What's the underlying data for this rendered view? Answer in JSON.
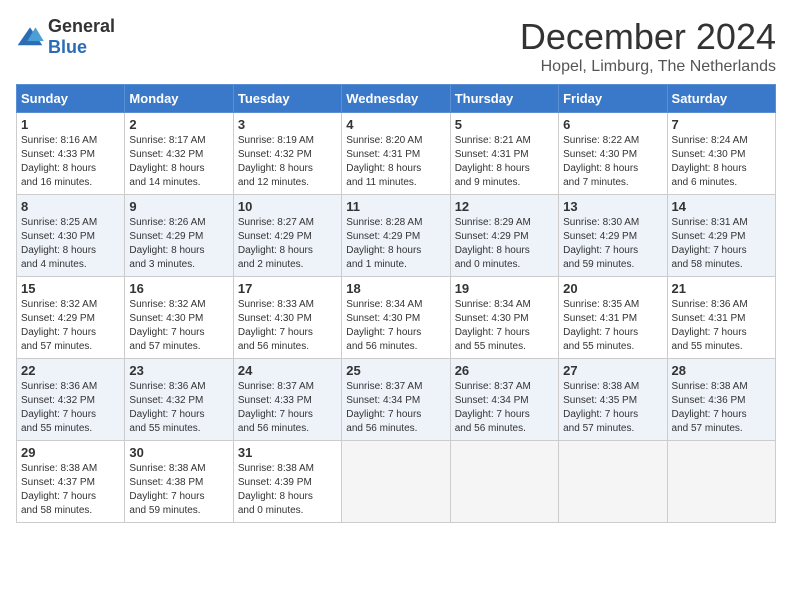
{
  "logo": {
    "general": "General",
    "blue": "Blue"
  },
  "title": "December 2024",
  "location": "Hopel, Limburg, The Netherlands",
  "days_of_week": [
    "Sunday",
    "Monday",
    "Tuesday",
    "Wednesday",
    "Thursday",
    "Friday",
    "Saturday"
  ],
  "weeks": [
    [
      {
        "day": "1",
        "info": "Sunrise: 8:16 AM\nSunset: 4:33 PM\nDaylight: 8 hours\nand 16 minutes."
      },
      {
        "day": "2",
        "info": "Sunrise: 8:17 AM\nSunset: 4:32 PM\nDaylight: 8 hours\nand 14 minutes."
      },
      {
        "day": "3",
        "info": "Sunrise: 8:19 AM\nSunset: 4:32 PM\nDaylight: 8 hours\nand 12 minutes."
      },
      {
        "day": "4",
        "info": "Sunrise: 8:20 AM\nSunset: 4:31 PM\nDaylight: 8 hours\nand 11 minutes."
      },
      {
        "day": "5",
        "info": "Sunrise: 8:21 AM\nSunset: 4:31 PM\nDaylight: 8 hours\nand 9 minutes."
      },
      {
        "day": "6",
        "info": "Sunrise: 8:22 AM\nSunset: 4:30 PM\nDaylight: 8 hours\nand 7 minutes."
      },
      {
        "day": "7",
        "info": "Sunrise: 8:24 AM\nSunset: 4:30 PM\nDaylight: 8 hours\nand 6 minutes."
      }
    ],
    [
      {
        "day": "8",
        "info": "Sunrise: 8:25 AM\nSunset: 4:30 PM\nDaylight: 8 hours\nand 4 minutes."
      },
      {
        "day": "9",
        "info": "Sunrise: 8:26 AM\nSunset: 4:29 PM\nDaylight: 8 hours\nand 3 minutes."
      },
      {
        "day": "10",
        "info": "Sunrise: 8:27 AM\nSunset: 4:29 PM\nDaylight: 8 hours\nand 2 minutes."
      },
      {
        "day": "11",
        "info": "Sunrise: 8:28 AM\nSunset: 4:29 PM\nDaylight: 8 hours\nand 1 minute."
      },
      {
        "day": "12",
        "info": "Sunrise: 8:29 AM\nSunset: 4:29 PM\nDaylight: 8 hours\nand 0 minutes."
      },
      {
        "day": "13",
        "info": "Sunrise: 8:30 AM\nSunset: 4:29 PM\nDaylight: 7 hours\nand 59 minutes."
      },
      {
        "day": "14",
        "info": "Sunrise: 8:31 AM\nSunset: 4:29 PM\nDaylight: 7 hours\nand 58 minutes."
      }
    ],
    [
      {
        "day": "15",
        "info": "Sunrise: 8:32 AM\nSunset: 4:29 PM\nDaylight: 7 hours\nand 57 minutes."
      },
      {
        "day": "16",
        "info": "Sunrise: 8:32 AM\nSunset: 4:30 PM\nDaylight: 7 hours\nand 57 minutes."
      },
      {
        "day": "17",
        "info": "Sunrise: 8:33 AM\nSunset: 4:30 PM\nDaylight: 7 hours\nand 56 minutes."
      },
      {
        "day": "18",
        "info": "Sunrise: 8:34 AM\nSunset: 4:30 PM\nDaylight: 7 hours\nand 56 minutes."
      },
      {
        "day": "19",
        "info": "Sunrise: 8:34 AM\nSunset: 4:30 PM\nDaylight: 7 hours\nand 55 minutes."
      },
      {
        "day": "20",
        "info": "Sunrise: 8:35 AM\nSunset: 4:31 PM\nDaylight: 7 hours\nand 55 minutes."
      },
      {
        "day": "21",
        "info": "Sunrise: 8:36 AM\nSunset: 4:31 PM\nDaylight: 7 hours\nand 55 minutes."
      }
    ],
    [
      {
        "day": "22",
        "info": "Sunrise: 8:36 AM\nSunset: 4:32 PM\nDaylight: 7 hours\nand 55 minutes."
      },
      {
        "day": "23",
        "info": "Sunrise: 8:36 AM\nSunset: 4:32 PM\nDaylight: 7 hours\nand 55 minutes."
      },
      {
        "day": "24",
        "info": "Sunrise: 8:37 AM\nSunset: 4:33 PM\nDaylight: 7 hours\nand 56 minutes."
      },
      {
        "day": "25",
        "info": "Sunrise: 8:37 AM\nSunset: 4:34 PM\nDaylight: 7 hours\nand 56 minutes."
      },
      {
        "day": "26",
        "info": "Sunrise: 8:37 AM\nSunset: 4:34 PM\nDaylight: 7 hours\nand 56 minutes."
      },
      {
        "day": "27",
        "info": "Sunrise: 8:38 AM\nSunset: 4:35 PM\nDaylight: 7 hours\nand 57 minutes."
      },
      {
        "day": "28",
        "info": "Sunrise: 8:38 AM\nSunset: 4:36 PM\nDaylight: 7 hours\nand 57 minutes."
      }
    ],
    [
      {
        "day": "29",
        "info": "Sunrise: 8:38 AM\nSunset: 4:37 PM\nDaylight: 7 hours\nand 58 minutes."
      },
      {
        "day": "30",
        "info": "Sunrise: 8:38 AM\nSunset: 4:38 PM\nDaylight: 7 hours\nand 59 minutes."
      },
      {
        "day": "31",
        "info": "Sunrise: 8:38 AM\nSunset: 4:39 PM\nDaylight: 8 hours\nand 0 minutes."
      },
      null,
      null,
      null,
      null
    ]
  ]
}
